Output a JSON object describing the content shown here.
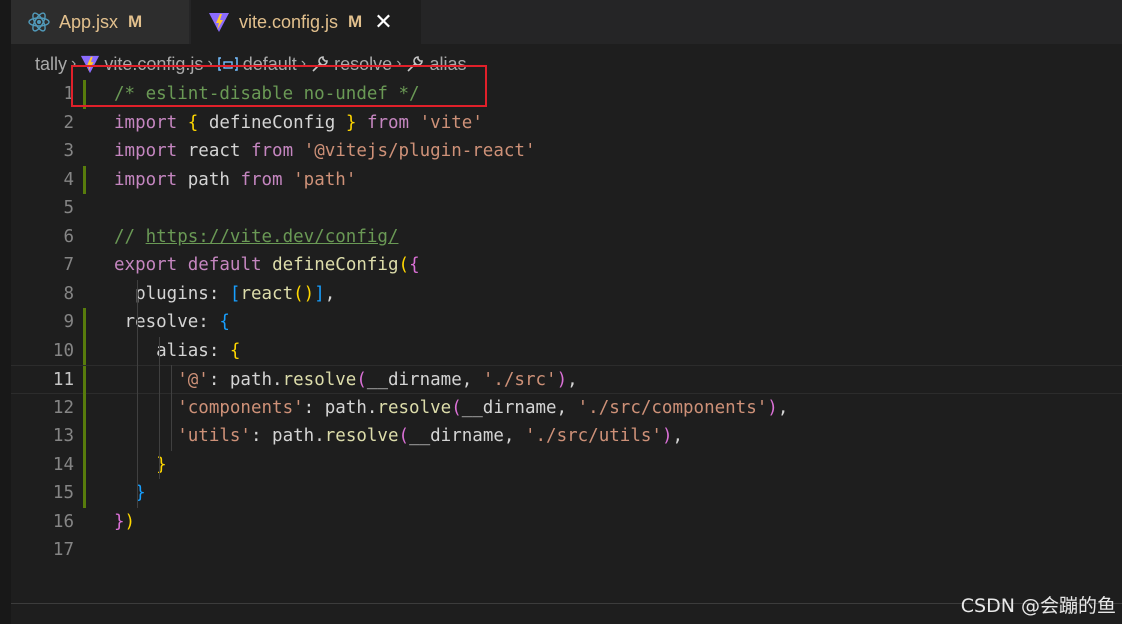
{
  "tabs": [
    {
      "name": "App.jsx",
      "status": "M",
      "icon": "react-icon",
      "color": "#e2c08d"
    },
    {
      "name": "vite.config.js",
      "status": "M",
      "icon": "vite-icon",
      "close": "✕",
      "color": "#e2c08d"
    }
  ],
  "breadcrumb": {
    "items": [
      "tally",
      "vite.config.js",
      "default",
      "resolve",
      "alias"
    ],
    "icons": [
      "",
      "vite-icon",
      "variable-icon",
      "wrench-icon",
      "wrench-icon"
    ],
    "separator": "›"
  },
  "editor": {
    "current_line": 11,
    "modified_lines": [
      1,
      4,
      9,
      10,
      11,
      12,
      13,
      14,
      15
    ],
    "line_numbers": [
      "1",
      "2",
      "3",
      "4",
      "5",
      "6",
      "7",
      "8",
      "9",
      "10",
      "11",
      "12",
      "13",
      "14",
      "15",
      "16",
      "17"
    ],
    "lines": [
      [
        {
          "t": "/* eslint-disable no-undef */",
          "c": "cmt"
        }
      ],
      [
        {
          "t": "import",
          "c": "kw2"
        },
        {
          "t": " ",
          "c": "txt"
        },
        {
          "t": "{",
          "c": "b1"
        },
        {
          "t": " ",
          "c": "txt"
        },
        {
          "t": "defineConfig",
          "c": "txt"
        },
        {
          "t": " ",
          "c": "txt"
        },
        {
          "t": "}",
          "c": "b1"
        },
        {
          "t": " ",
          "c": "txt"
        },
        {
          "t": "from",
          "c": "kw2"
        },
        {
          "t": " ",
          "c": "txt"
        },
        {
          "t": "'vite'",
          "c": "str"
        }
      ],
      [
        {
          "t": "import",
          "c": "kw2"
        },
        {
          "t": " react ",
          "c": "txt"
        },
        {
          "t": "from",
          "c": "kw2"
        },
        {
          "t": " ",
          "c": "txt"
        },
        {
          "t": "'@vitejs/plugin-react'",
          "c": "str"
        }
      ],
      [
        {
          "t": "import",
          "c": "kw2"
        },
        {
          "t": " path ",
          "c": "txt"
        },
        {
          "t": "from",
          "c": "kw2"
        },
        {
          "t": " ",
          "c": "txt"
        },
        {
          "t": "'path'",
          "c": "str"
        }
      ],
      [],
      [
        {
          "t": "// ",
          "c": "cmt"
        },
        {
          "t": "https://vite.dev/config/",
          "c": "cmt link"
        }
      ],
      [
        {
          "t": "export",
          "c": "kw2"
        },
        {
          "t": " ",
          "c": "txt"
        },
        {
          "t": "default",
          "c": "kw2"
        },
        {
          "t": " ",
          "c": "txt"
        },
        {
          "t": "defineConfig",
          "c": "fn"
        },
        {
          "t": "(",
          "c": "b1"
        },
        {
          "t": "{",
          "c": "b2"
        }
      ],
      [
        {
          "t": "  plugins: ",
          "c": "txt"
        },
        {
          "t": "[",
          "c": "b3"
        },
        {
          "t": "react",
          "c": "fn"
        },
        {
          "t": "()",
          "c": "b1"
        },
        {
          "t": "]",
          "c": "b3"
        },
        {
          "t": ",",
          "c": "txt"
        }
      ],
      [
        {
          "t": " resolve: ",
          "c": "txt"
        },
        {
          "t": "{",
          "c": "b3"
        }
      ],
      [
        {
          "t": "    alias: ",
          "c": "txt"
        },
        {
          "t": "{",
          "c": "b1"
        }
      ],
      [
        {
          "t": "      ",
          "c": "txt"
        },
        {
          "t": "'@'",
          "c": "str"
        },
        {
          "t": ": path.",
          "c": "txt"
        },
        {
          "t": "resolve",
          "c": "fn"
        },
        {
          "t": "(",
          "c": "b2"
        },
        {
          "t": "__dirname, ",
          "c": "txt"
        },
        {
          "t": "'./src'",
          "c": "str"
        },
        {
          "t": ")",
          "c": "b2"
        },
        {
          "t": ",",
          "c": "txt"
        }
      ],
      [
        {
          "t": "      ",
          "c": "txt"
        },
        {
          "t": "'components'",
          "c": "str"
        },
        {
          "t": ": path.",
          "c": "txt"
        },
        {
          "t": "resolve",
          "c": "fn"
        },
        {
          "t": "(",
          "c": "b2"
        },
        {
          "t": "__dirname, ",
          "c": "txt"
        },
        {
          "t": "'./src/components'",
          "c": "str"
        },
        {
          "t": ")",
          "c": "b2"
        },
        {
          "t": ",",
          "c": "txt"
        }
      ],
      [
        {
          "t": "      ",
          "c": "txt"
        },
        {
          "t": "'utils'",
          "c": "str"
        },
        {
          "t": ": path.",
          "c": "txt"
        },
        {
          "t": "resolve",
          "c": "fn"
        },
        {
          "t": "(",
          "c": "b2"
        },
        {
          "t": "__dirname, ",
          "c": "txt"
        },
        {
          "t": "'./src/utils'",
          "c": "str"
        },
        {
          "t": ")",
          "c": "b2"
        },
        {
          "t": ",",
          "c": "txt"
        }
      ],
      [
        {
          "t": "    ",
          "c": "txt"
        },
        {
          "t": "}",
          "c": "b1"
        }
      ],
      [
        {
          "t": "  ",
          "c": "txt"
        },
        {
          "t": "}",
          "c": "b3"
        }
      ],
      [
        {
          "t": "}",
          "c": "b2"
        },
        {
          "t": ")",
          "c": "b1"
        }
      ],
      []
    ]
  },
  "colors": {
    "highlight_box": "#e0202a",
    "modified_gutter": "#587c0c",
    "modified_tab_label": "#e2c08d"
  },
  "watermark": "CSDN @会蹦的鱼"
}
